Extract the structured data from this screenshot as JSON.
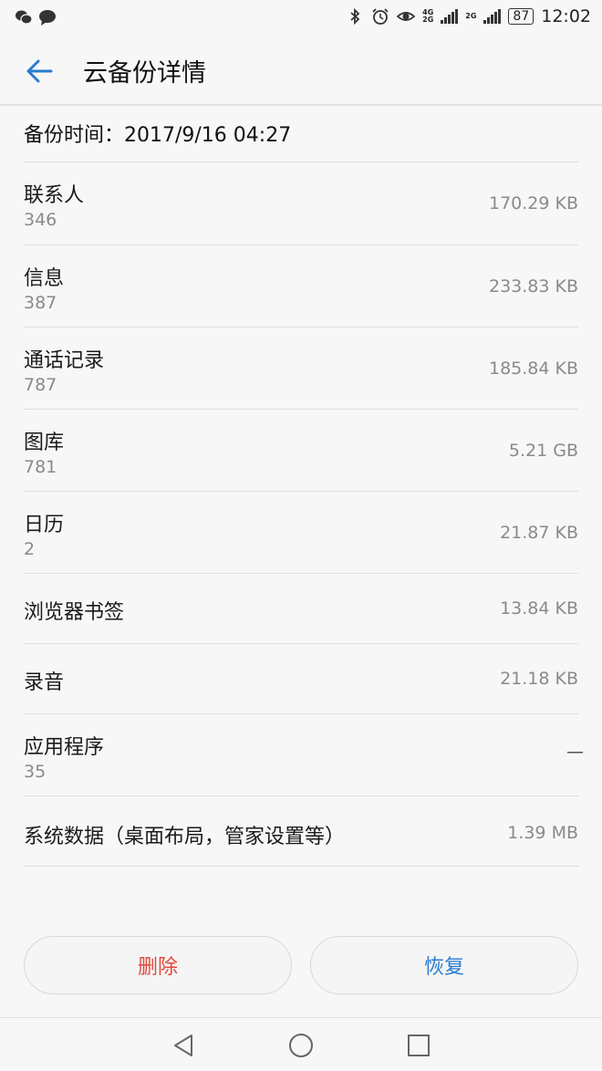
{
  "status_bar": {
    "time": "12:02",
    "battery": "87",
    "network_1": [
      "4G",
      "2G"
    ],
    "network_2": "2G",
    "left_icons": [
      "wechat-icon",
      "chat-icon"
    ],
    "right_icons": [
      "bluetooth-icon",
      "alarm-icon",
      "eye-icon",
      "signal-icon",
      "signal-icon",
      "battery-icon"
    ]
  },
  "header": {
    "title": "云备份详情",
    "back_icon": "back-arrow-icon"
  },
  "backup_time": "备份时间：2017/9/16 04:27",
  "items": [
    {
      "label": "联系人",
      "count": "346",
      "size": "170.29 KB"
    },
    {
      "label": "信息",
      "count": "387",
      "size": "233.83 KB"
    },
    {
      "label": "通话记录",
      "count": "787",
      "size": "185.84 KB"
    },
    {
      "label": "图库",
      "count": "781",
      "size": "5.21 GB"
    },
    {
      "label": "日历",
      "count": "2",
      "size": "21.87 KB"
    },
    {
      "label": "浏览器书签",
      "count": "",
      "size": "13.84 KB"
    },
    {
      "label": "录音",
      "count": "",
      "size": "21.18 KB"
    },
    {
      "label": "应用程序",
      "count": "35",
      "size": "—"
    },
    {
      "label": "系统数据（桌面布局，管家设置等）",
      "count": "",
      "size": "1.39 MB"
    }
  ],
  "buttons": {
    "delete": "删除",
    "restore": "恢复"
  },
  "colors": {
    "accent": "#2a7ccf",
    "danger": "#e2483d",
    "background": "#f7f7f7"
  },
  "nav": [
    "back-triangle-icon",
    "home-circle-icon",
    "recents-square-icon"
  ]
}
